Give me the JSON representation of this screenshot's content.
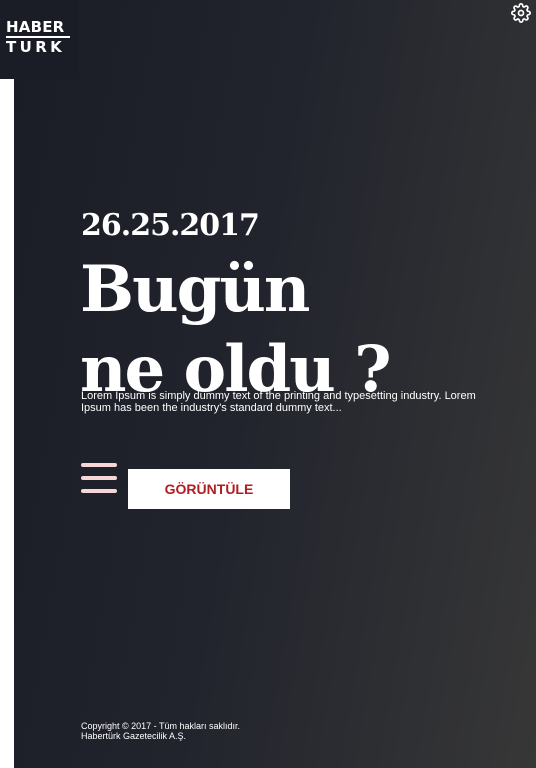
{
  "logo": {
    "line1": "HABER",
    "line2": "TURK"
  },
  "settings": {
    "icon": "gear-icon"
  },
  "hero": {
    "date": "26.25.2017",
    "headline_line1": "Bugün",
    "headline_line2": "ne oldu ?",
    "body": "Lorem Ipsum is simply dummy text of the printing and typesetting industry. Lorem Ipsum has been the industry's standard dummy text..."
  },
  "actions": {
    "menu_icon": "hamburger-menu-icon",
    "view_label": "GÖRÜNTÜLE"
  },
  "footer": {
    "line1": "Copyright © 2017 - Tüm hakları saklıdır.",
    "line2": "Habertürk Gazetecilik A.Ş."
  },
  "colors": {
    "button_text": "#b01d22",
    "menu_icon": "#f6d6d6",
    "background_start": "#1a1c26",
    "background_end": "#373737"
  }
}
